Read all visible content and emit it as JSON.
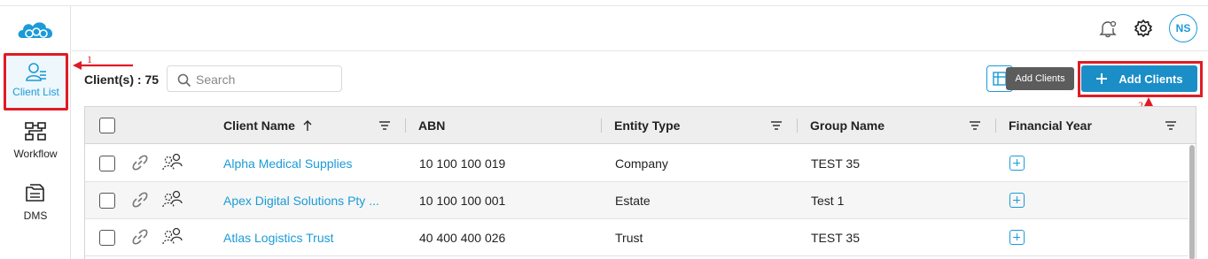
{
  "sidebar": {
    "items": [
      {
        "label": "Client List",
        "icon": "client-list-icon"
      },
      {
        "label": "Workflow",
        "icon": "workflow-icon"
      },
      {
        "label": "DMS",
        "icon": "dms-icon"
      }
    ]
  },
  "header": {
    "avatar_initials": "NS"
  },
  "toolbar": {
    "client_count_label": "Client(s) : 75",
    "search_placeholder": "Search",
    "tooltip_text": "Add Clients",
    "add_button_label": "Add Clients"
  },
  "annotations": {
    "step1": "1",
    "step2": "2"
  },
  "table": {
    "columns": [
      "Client Name",
      "ABN",
      "Entity Type",
      "Group Name",
      "Financial Year"
    ],
    "rows": [
      {
        "client_name": "Alpha Medical Supplies",
        "abn": "10 100 100 019",
        "entity_type": "Company",
        "group_name": "TEST 35"
      },
      {
        "client_name": "Apex Digital Solutions Pty ...",
        "abn": "10 100 100 001",
        "entity_type": "Estate",
        "group_name": "Test 1"
      },
      {
        "client_name": "Atlas Logistics Trust",
        "abn": "40 400 400 026",
        "entity_type": "Trust",
        "group_name": "TEST 35"
      }
    ]
  },
  "colors": {
    "accent": "#1b9bd7",
    "button": "#1b8ec8",
    "annotation": "#e01b24"
  }
}
